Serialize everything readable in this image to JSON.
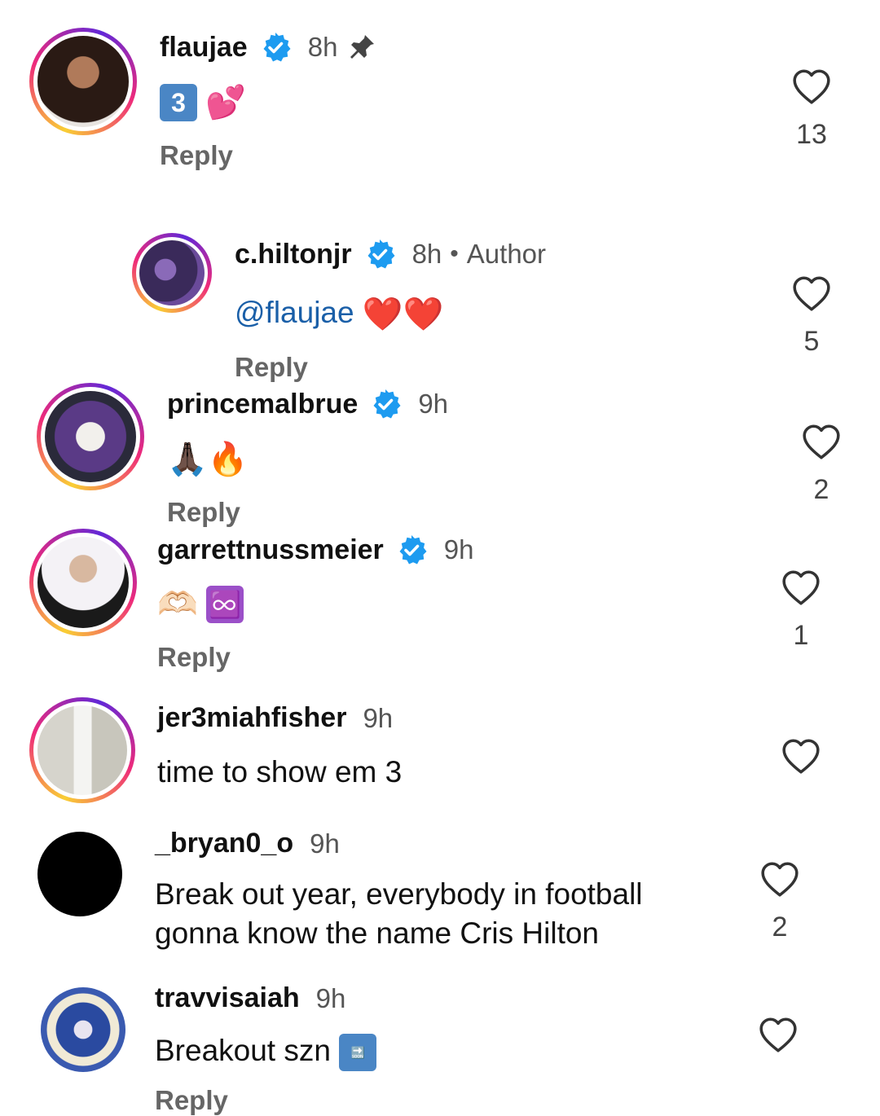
{
  "comments": [
    {
      "username": "flaujae",
      "time": "8h",
      "text": "",
      "emoji": [
        "3️⃣",
        "💕"
      ],
      "reply_label": "Reply",
      "likes": "13",
      "pinned": true,
      "verified": true
    },
    {
      "username": "c.hiltonjr",
      "time": "8h",
      "badge": "Author",
      "mention": "@flaujae",
      "emoji": [
        "❤️",
        "❤️"
      ],
      "reply_label": "Reply",
      "likes": "5",
      "verified": true
    },
    {
      "username": "princemalbrue",
      "time": "9h",
      "emoji": [
        "🙏🏿",
        "🔥"
      ],
      "reply_label": "Reply",
      "likes": "2",
      "verified": true
    },
    {
      "username": "garrettnussmeier",
      "time": "9h",
      "emoji": [
        "🫶🏻",
        "♾️"
      ],
      "reply_label": "Reply",
      "likes": "1",
      "verified": true
    },
    {
      "username": "jer3miahfisher",
      "time": "9h",
      "text": "time to show em 3"
    },
    {
      "username": "_bryan0_o",
      "time": "9h",
      "text_line1": "Break out year, everybody in football",
      "text_line2": "gonna know the name Cris Hilton",
      "likes": "2"
    },
    {
      "username": "travvisaiah",
      "time": "9h",
      "text": "Breakout szn",
      "emoji": [
        "🔜"
      ],
      "reply_label": "Reply"
    }
  ],
  "colors": {
    "verified": "#1d9bf0",
    "mention": "#1a5fa8",
    "ring": [
      "#f9ce34",
      "#ee2a7b",
      "#6228d7"
    ]
  },
  "icons": {
    "like": "heart-outline-icon",
    "verified": "verified-badge-icon",
    "pin": "pin-icon"
  }
}
